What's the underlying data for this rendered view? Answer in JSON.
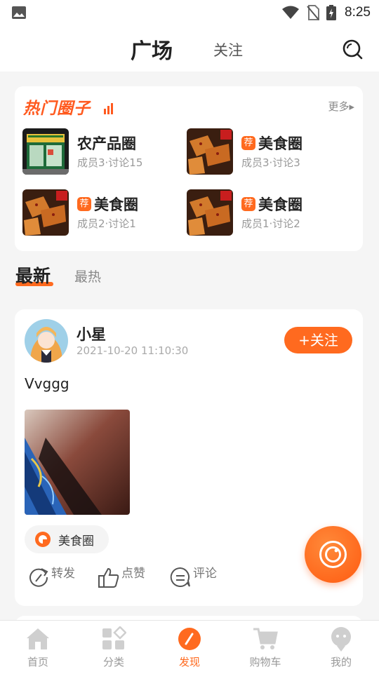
{
  "status_bar": {
    "time": "8:25"
  },
  "header": {
    "title": "广场",
    "follow_tab": "关注"
  },
  "hot_circles": {
    "title": "热门圈子",
    "more_label": "更多▸",
    "items": [
      {
        "name": "农产品圈",
        "stats": "成员3·讨论15",
        "recommended": false,
        "badge": ""
      },
      {
        "name": "美食圈",
        "stats": "成员3·讨论3",
        "recommended": true,
        "badge": "荐"
      },
      {
        "name": "美食圈",
        "stats": "成员2·讨论1",
        "recommended": true,
        "badge": "荐"
      },
      {
        "name": "美食圈",
        "stats": "成员1·讨论2",
        "recommended": true,
        "badge": "荐"
      }
    ]
  },
  "feed_tabs": {
    "latest": "最新",
    "hot": "最热"
  },
  "post": {
    "username": "小星",
    "time": "2021-10-20 11:10:30",
    "follow_label": "+关注",
    "text": "Vvggg",
    "circle_tag": "美食圈",
    "actions": {
      "forward": "转发",
      "like": "点赞",
      "comment": "评论"
    }
  },
  "bottom_nav": {
    "items": [
      {
        "label": "首页",
        "icon": "home-icon"
      },
      {
        "label": "分类",
        "icon": "category-icon"
      },
      {
        "label": "发现",
        "icon": "discover-icon",
        "active": true
      },
      {
        "label": "购物车",
        "icon": "cart-icon"
      },
      {
        "label": "我的",
        "icon": "profile-icon"
      }
    ]
  },
  "colors": {
    "accent": "#ff6a1f",
    "background": "#f5f5f5",
    "muted": "#999999"
  }
}
